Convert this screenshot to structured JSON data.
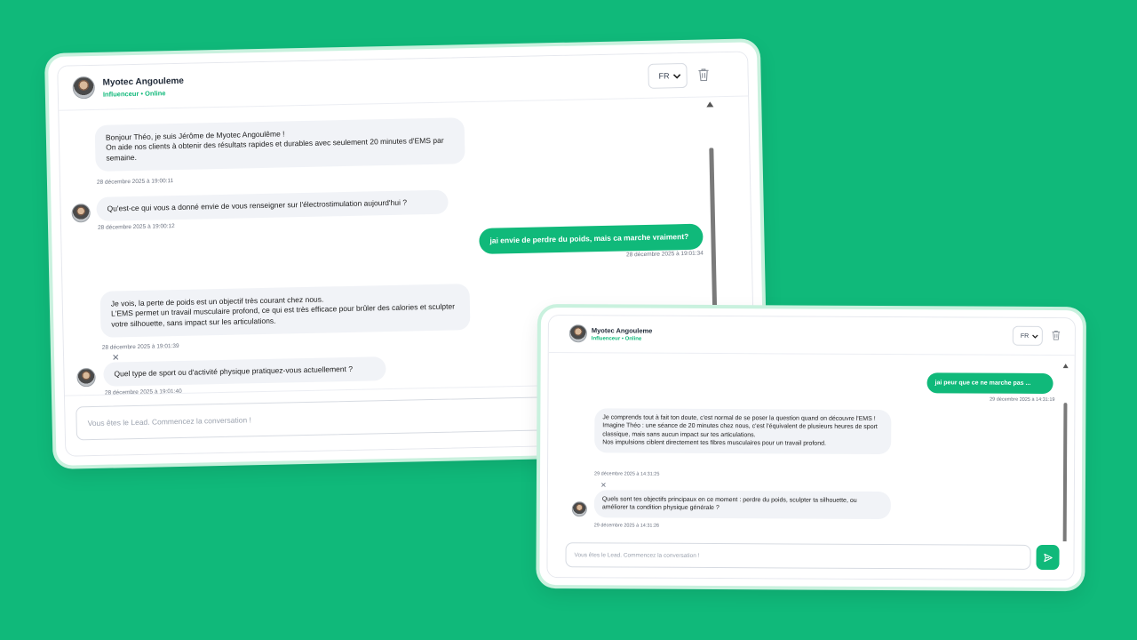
{
  "card_a": {
    "header": {
      "name": "Myotec Angouleme",
      "status": "Influenceur • Online",
      "lang": "FR"
    },
    "messages": [
      {
        "text": "Bonjour Théo, je suis Jérôme de Myotec Angoulême !\nOn aide nos clients à obtenir des résultats rapides et durables avec seulement 20 minutes d'EMS par semaine.",
        "ts": "28 décembre 2025 à 19:00:11"
      },
      {
        "text": "Qu'est-ce qui vous a donné envie de vous renseigner sur l'électrostimulation aujourd'hui ?",
        "ts": "28 décembre 2025 à 19:00:12"
      },
      {
        "text": "jai envie de perdre du poids, mais ca marche vraiment?",
        "ts": "28 décembre 2025 à 19:01:34"
      },
      {
        "text": "Je vois, la perte de poids est un objectif très courant chez nous.\nL'EMS permet un travail musculaire profond, ce qui est très efficace pour brûler des calories et sculpter votre silhouette, sans impact sur les articulations.",
        "ts": "28 décembre 2025 à 19:01:39"
      },
      {
        "text": "Quel type de sport ou d'activité physique pratiquez-vous actuellement ?",
        "ts": "28 décembre 2025 à 19:01:40"
      }
    ],
    "input_placeholder": "Vous êtes le Lead. Commencez la conversation !"
  },
  "card_b": {
    "header": {
      "name": "Myotec Angouleme",
      "status": "Influenceur • Online",
      "lang": "FR"
    },
    "messages": [
      {
        "text": "jai peur que ce ne marche pas ...",
        "ts": "29 décembre 2025 à 14:31:19"
      },
      {
        "text": "Je comprends tout à fait ton doute, c'est normal de se poser la question quand on découvre l'EMS !\nImagine Théo : une séance de 20 minutes chez nous, c'est l'équivalent de plusieurs heures de sport classique, mais sans aucun impact sur tes articulations.\nNos impulsions ciblent directement tes fibres musculaires pour un travail profond.",
        "ts": "29 décembre 2025 à 14:31:25"
      },
      {
        "text": "Quels sont tes objectifs principaux en ce moment : perdre du poids, sculpter ta silhouette, ou améliorer ta condition physique générale ?",
        "ts": "29 décembre 2025 à 14:31:26"
      }
    ],
    "input_placeholder": "Vous êtes le Lead. Commencez la conversation !"
  },
  "icons": {
    "trash": "trash-icon",
    "send": "send-icon",
    "close": "close-icon",
    "chevron": "chevron-down-icon"
  },
  "colors": {
    "accent": "#10b97a",
    "background": "#10b97a",
    "bubble_in": "#f1f3f7"
  }
}
